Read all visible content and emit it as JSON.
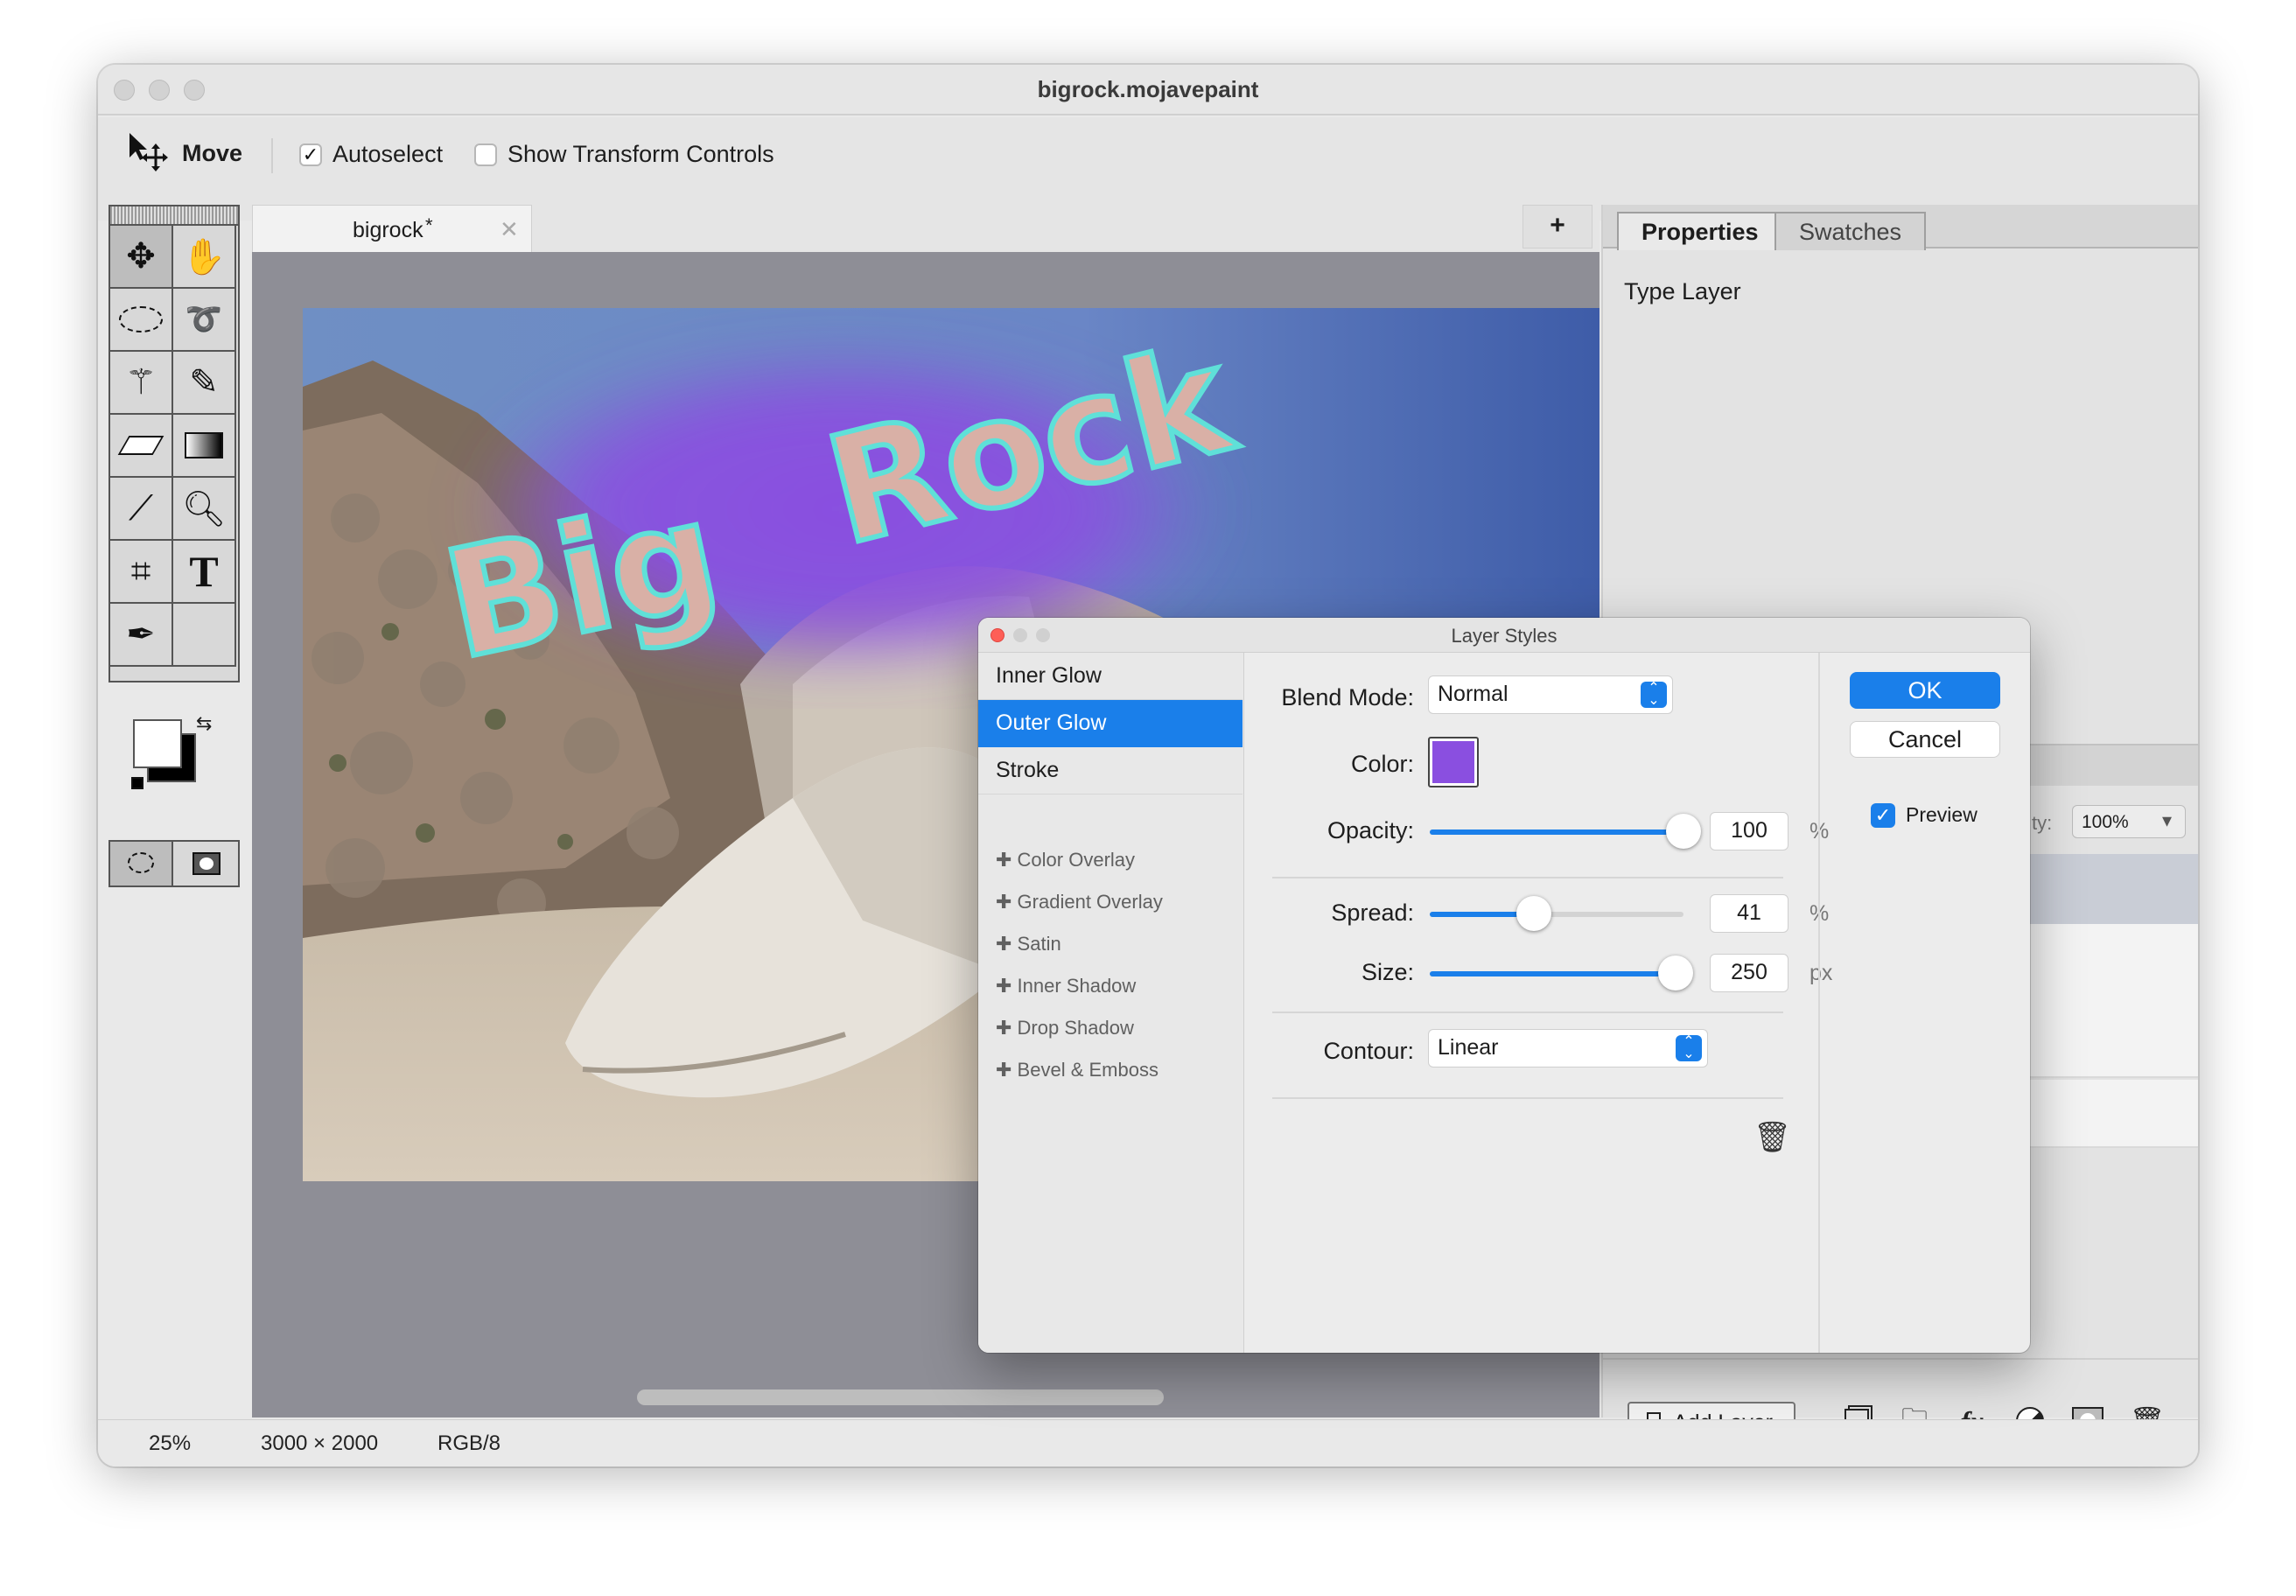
{
  "window": {
    "title": "bigrock.mojavepaint"
  },
  "options_bar": {
    "tool_name": "Move",
    "autoselect_label": "Autoselect",
    "autoselect_checked": true,
    "show_transform_label": "Show Transform Controls",
    "show_transform_checked": false
  },
  "document": {
    "tab_label": "bigrock",
    "modified_mark": "*",
    "new_tab_label": "+",
    "close_icon": "close-icon"
  },
  "canvas_text": "Big Rock",
  "status": {
    "zoom": "25%",
    "size": "3000 × 2000",
    "mode": "RGB/8"
  },
  "panel": {
    "tabs": [
      "Properties",
      "Swatches"
    ],
    "active_tab": "Properties",
    "properties_title": "Type Layer",
    "opacity_label_partial": "ty:",
    "opacity_value": "100%",
    "add_layer_label": "Add Layer"
  },
  "dialog": {
    "title": "Layer Styles",
    "effects": [
      "Inner Glow",
      "Outer Glow",
      "Stroke"
    ],
    "selected_effect": "Outer Glow",
    "more_effects": [
      "Color Overlay",
      "Gradient Overlay",
      "Satin",
      "Inner Shadow",
      "Drop Shadow",
      "Bevel & Emboss"
    ],
    "blend_mode_label": "Blend Mode:",
    "blend_mode": "Normal",
    "color_label": "Color:",
    "color": "#8a4fe0",
    "opacity_label": "Opacity:",
    "opacity": "100",
    "opacity_unit": "%",
    "opacity_fraction": 1.0,
    "spread_label": "Spread:",
    "spread": "41",
    "spread_unit": "%",
    "spread_fraction": 0.41,
    "size_label": "Size:",
    "size": "250",
    "size_unit": "px",
    "size_fraction": 0.97,
    "contour_label": "Contour:",
    "contour": "Linear",
    "ok_label": "OK",
    "cancel_label": "Cancel",
    "preview_label": "Preview",
    "preview_checked": true
  },
  "colors": {
    "accent": "#1a7fea",
    "glow": "#8a4fe0",
    "text_fill": "#d9b0a6",
    "text_stroke": "#5fe0d8"
  }
}
